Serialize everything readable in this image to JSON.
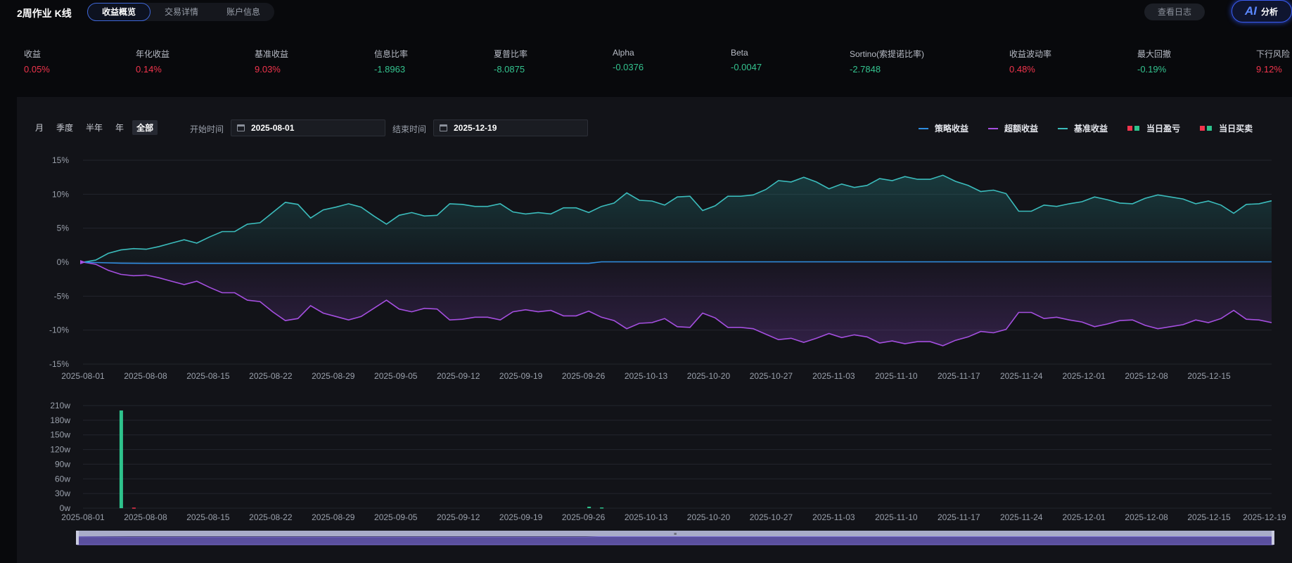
{
  "header": {
    "title": "2周作业 K线",
    "tabs": [
      {
        "label": "收益概览",
        "active": true
      },
      {
        "label": "交易详情",
        "active": false
      },
      {
        "label": "账户信息",
        "active": false
      }
    ],
    "log_button": "查看日志",
    "ai_button": {
      "mark": "AI",
      "label": "分析"
    }
  },
  "metrics": [
    {
      "label": "收益",
      "value": "0.05%",
      "tone": "pos"
    },
    {
      "label": "年化收益",
      "value": "0.14%",
      "tone": "pos"
    },
    {
      "label": "基准收益",
      "value": "9.03%",
      "tone": "pos"
    },
    {
      "label": "信息比率",
      "value": "-1.8963",
      "tone": "neg"
    },
    {
      "label": "夏普比率",
      "value": "-8.0875",
      "tone": "neg"
    },
    {
      "label": "Alpha",
      "value": "-0.0376",
      "tone": "neg"
    },
    {
      "label": "Beta",
      "value": "-0.0047",
      "tone": "neg"
    },
    {
      "label": "Sortino(索提诺比率)",
      "value": "-2.7848",
      "tone": "neg"
    },
    {
      "label": "收益波动率",
      "value": "0.48%",
      "tone": "pos"
    },
    {
      "label": "最大回撤",
      "value": "-0.19%",
      "tone": "neg"
    },
    {
      "label": "下行风险",
      "value": "9.12%",
      "tone": "pos"
    }
  ],
  "controls": {
    "ranges": [
      {
        "label": "月",
        "active": false
      },
      {
        "label": "季度",
        "active": false
      },
      {
        "label": "半年",
        "active": false
      },
      {
        "label": "年",
        "active": false
      },
      {
        "label": "全部",
        "active": true
      }
    ],
    "start_label": "开始时间",
    "start_value": "2025-08-01",
    "end_label": "结束时间",
    "end_value": "2025-12-19"
  },
  "legend": {
    "strategy": "策略收益",
    "excess": "超额收益",
    "benchmark": "基准收益",
    "daily_pnl": "当日盈亏",
    "daily_trade": "当日买卖"
  },
  "colors": {
    "strategy": "#2f8de0",
    "excess": "#a54fe0",
    "benchmark": "#3bbcbc",
    "positive": "#f0344c",
    "negative": "#2ec28c"
  },
  "chart_data": [
    {
      "type": "line",
      "x_start": "2025-08-01",
      "x_end": "2025-12-19",
      "x_ticks": [
        "2025-08-01",
        "2025-08-08",
        "2025-08-15",
        "2025-08-22",
        "2025-08-29",
        "2025-09-05",
        "2025-09-12",
        "2025-09-19",
        "2025-09-26",
        "2025-10-13",
        "2025-10-20",
        "2025-10-27",
        "2025-11-03",
        "2025-11-10",
        "2025-11-17",
        "2025-11-24",
        "2025-12-01",
        "2025-12-08",
        "2025-12-15"
      ],
      "y_ticks": [
        "15%",
        "10%",
        "5%",
        "0%",
        "-5%",
        "-10%",
        "-15%"
      ],
      "ylim": [
        -15,
        15
      ],
      "grid": true,
      "legend_position": "top-right",
      "series": [
        {
          "name": "基准收益",
          "values": [
            0,
            0.3,
            1.3,
            1.8,
            2.0,
            1.9,
            2.3,
            2.8,
            3.3,
            2.8,
            3.7,
            4.5,
            4.5,
            5.6,
            5.8,
            7.3,
            8.8,
            8.5,
            6.5,
            7.7,
            8.1,
            8.6,
            8.1,
            6.8,
            5.6,
            6.9,
            7.3,
            6.8,
            6.9,
            8.6,
            8.5,
            8.2,
            8.2,
            8.6,
            7.4,
            7.1,
            7.3,
            7.1,
            8.0,
            8.0,
            7.3,
            8.2,
            8.7,
            10.2,
            9.1,
            9.0,
            8.4,
            9.6,
            9.7,
            7.6,
            8.3,
            9.7,
            9.7,
            9.9,
            10.7,
            12.0,
            11.8,
            12.5,
            11.8,
            10.8,
            11.5,
            11.0,
            11.3,
            12.3,
            12.0,
            12.6,
            12.2,
            12.2,
            12.8,
            11.9,
            11.3,
            10.4,
            10.6,
            10.1,
            7.5,
            7.5,
            8.4,
            8.2,
            8.6,
            8.9,
            9.6,
            9.2,
            8.7,
            8.6,
            9.4,
            9.9,
            9.6,
            9.3,
            8.6,
            9.0,
            8.4,
            7.2,
            8.5,
            8.6,
            9.03
          ]
        },
        {
          "name": "超额收益",
          "values": [
            0,
            -0.3,
            -1.2,
            -1.8,
            -2.0,
            -1.9,
            -2.3,
            -2.8,
            -3.3,
            -2.8,
            -3.7,
            -4.5,
            -4.5,
            -5.6,
            -5.8,
            -7.3,
            -8.6,
            -8.3,
            -6.4,
            -7.5,
            -8.0,
            -8.5,
            -8.0,
            -6.8,
            -5.6,
            -6.9,
            -7.3,
            -6.8,
            -6.9,
            -8.5,
            -8.4,
            -8.1,
            -8.1,
            -8.5,
            -7.3,
            -7.0,
            -7.3,
            -7.1,
            -7.9,
            -7.9,
            -7.2,
            -8.1,
            -8.6,
            -9.8,
            -9.0,
            -8.9,
            -8.3,
            -9.5,
            -9.6,
            -7.5,
            -8.2,
            -9.6,
            -9.6,
            -9.8,
            -10.6,
            -11.4,
            -11.2,
            -11.8,
            -11.2,
            -10.5,
            -11.1,
            -10.7,
            -11.0,
            -11.9,
            -11.6,
            -12.0,
            -11.7,
            -11.7,
            -12.3,
            -11.5,
            -11.0,
            -10.2,
            -10.4,
            -9.9,
            -7.4,
            -7.4,
            -8.3,
            -8.1,
            -8.5,
            -8.8,
            -9.5,
            -9.1,
            -8.6,
            -8.5,
            -9.3,
            -9.8,
            -9.5,
            -9.2,
            -8.5,
            -8.9,
            -8.3,
            -7.1,
            -8.4,
            -8.5,
            -8.9
          ]
        },
        {
          "name": "策略收益",
          "values": [
            0,
            -0.05,
            -0.1,
            -0.15,
            -0.17,
            -0.18,
            -0.18,
            -0.18,
            -0.18,
            -0.18,
            -0.18,
            -0.18,
            -0.18,
            -0.18,
            -0.18,
            -0.18,
            -0.18,
            -0.18,
            -0.18,
            -0.18,
            -0.18,
            -0.18,
            -0.18,
            -0.18,
            -0.18,
            -0.18,
            -0.18,
            -0.18,
            -0.18,
            -0.18,
            -0.18,
            -0.18,
            -0.18,
            -0.18,
            -0.18,
            -0.18,
            -0.18,
            -0.18,
            -0.18,
            -0.18,
            -0.18,
            0.05,
            0.05,
            0.05,
            0.05,
            0.05,
            0.05,
            0.05,
            0.05,
            0.05,
            0.05,
            0.05,
            0.05,
            0.05,
            0.05,
            0.05,
            0.05,
            0.05,
            0.05,
            0.05,
            0.05,
            0.05,
            0.05,
            0.05,
            0.05,
            0.05,
            0.05,
            0.05,
            0.05,
            0.05,
            0.05,
            0.05,
            0.05,
            0.05,
            0.05,
            0.05,
            0.05,
            0.05,
            0.05,
            0.05,
            0.05,
            0.05,
            0.05,
            0.05,
            0.05,
            0.05,
            0.05,
            0.05,
            0.05,
            0.05,
            0.05,
            0.05,
            0.05,
            0.05,
            0.05
          ]
        }
      ]
    },
    {
      "type": "bar",
      "x_ticks": [
        "2025-08-01",
        "2025-08-08",
        "2025-08-15",
        "2025-08-22",
        "2025-08-29",
        "2025-09-05",
        "2025-09-12",
        "2025-09-19",
        "2025-09-26",
        "2025-10-13",
        "2025-10-20",
        "2025-10-27",
        "2025-11-03",
        "2025-11-10",
        "2025-11-17",
        "2025-11-24",
        "2025-12-01",
        "2025-12-08",
        "2025-12-15",
        "2025-12-19"
      ],
      "y_ticks": [
        "210w",
        "180w",
        "150w",
        "120w",
        "90w",
        "60w",
        "30w",
        "0w"
      ],
      "ylim": [
        0,
        210
      ],
      "grid": true,
      "bars": [
        {
          "index": 3,
          "value": 200,
          "series": "当日买卖",
          "sign": "negative"
        },
        {
          "index": 4,
          "value": 1.2,
          "series": "当日盈亏",
          "sign": "positive"
        },
        {
          "index": 40,
          "value": 3,
          "series": "当日买卖",
          "sign": "negative"
        },
        {
          "index": 41,
          "value": 1.5,
          "series": "当日买卖",
          "sign": "negative"
        }
      ]
    }
  ]
}
